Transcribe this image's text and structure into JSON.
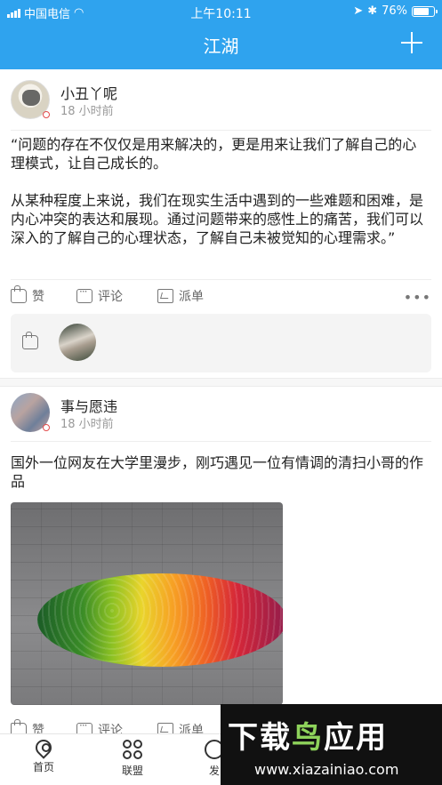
{
  "status_bar": {
    "carrier": "中国电信",
    "time": "上午10:11",
    "battery": "76%"
  },
  "header": {
    "title": "江湖",
    "add_icon": "plus-icon"
  },
  "posts": [
    {
      "author": "小丑丫呢",
      "time": "18 小时前",
      "text": "“问题的存在不仅仅是用来解决的，更是用来让我们了解自己的心理模式，让自己成长的。\n\n从某种程度上来说，我们在现实生活中遇到的一些难题和困难，是内心冲突的表达和展现。通过问题带来的感性上的痛苦，我们可以深入的了解自己的心理状态，了解自己未被觉知的心理需求。”",
      "actions": {
        "like": "赞",
        "comment": "评论",
        "dispatch": "派单",
        "more": "•••"
      }
    },
    {
      "author": "事与愿违",
      "time": "18 小时前",
      "text": "国外一位网友在大学里漫步，刚巧遇见一位有情调的清扫小哥的作品",
      "actions": {
        "like": "赞",
        "comment": "评论",
        "dispatch": "派单"
      }
    }
  ],
  "tabbar": {
    "items": [
      {
        "label": "首页",
        "icon": "location-pin-icon"
      },
      {
        "label": "联盟",
        "icon": "clover-icon"
      },
      {
        "label": "发",
        "icon": "circle-plus-icon"
      }
    ]
  },
  "watermark": {
    "title_part1": "下载",
    "title_part2": "鸟",
    "title_part3": "应用",
    "url": "www.xiazainiao.com"
  },
  "colors": {
    "header_bg": "#2fa3ee",
    "text": "#222222",
    "muted": "#999999"
  }
}
